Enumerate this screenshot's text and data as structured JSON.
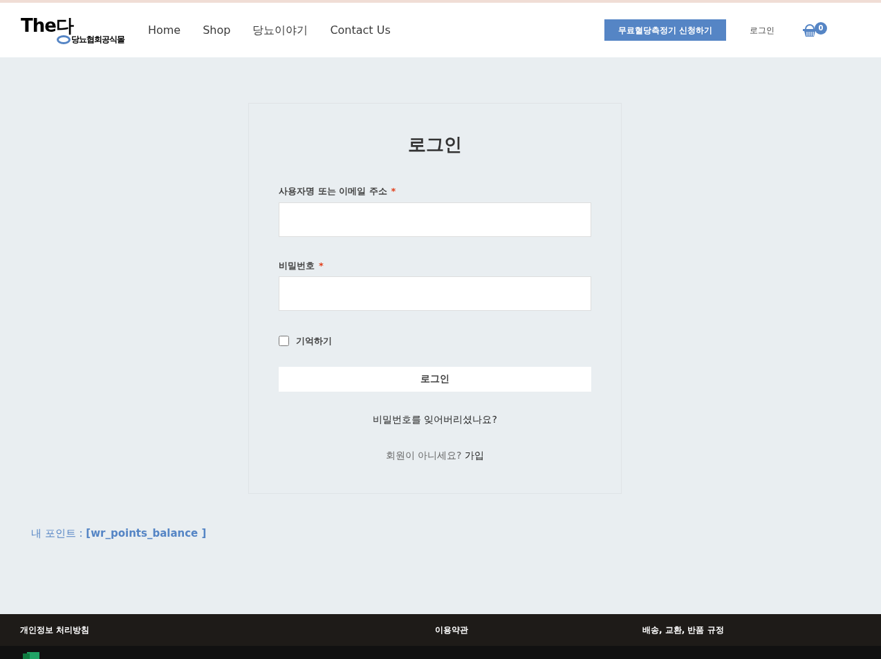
{
  "header": {
    "logo": {
      "main": "The다",
      "sub": "당뇨협회공식몰"
    },
    "nav": [
      {
        "label": "Home"
      },
      {
        "label": "Shop"
      },
      {
        "label": "당뇨이야기"
      },
      {
        "label": "Contact Us"
      }
    ],
    "cta_button": "무료혈당측정기 신청하기",
    "login_link": "로그인",
    "cart_count": "0"
  },
  "login_form": {
    "title": "로그인",
    "fields": [
      {
        "label": "사용자명 또는 이메일 주소",
        "required_mark": "*"
      },
      {
        "label": "비밀번호",
        "required_mark": "*"
      }
    ],
    "remember": {
      "label": "기억하기",
      "checked": false
    },
    "submit": "로그인",
    "lost_password": "비밀번호를 잊어버리셨나요?",
    "register": {
      "prompt": "회원이 아니세요?",
      "link": "가입"
    }
  },
  "points": "내 포인트 : **[wr_points_balance ]**",
  "footer": {
    "links": [
      {
        "label": "개인정보 처리방침"
      },
      {
        "label": "이용약관"
      },
      {
        "label": "배송, 교환, 반품 규정"
      }
    ]
  }
}
